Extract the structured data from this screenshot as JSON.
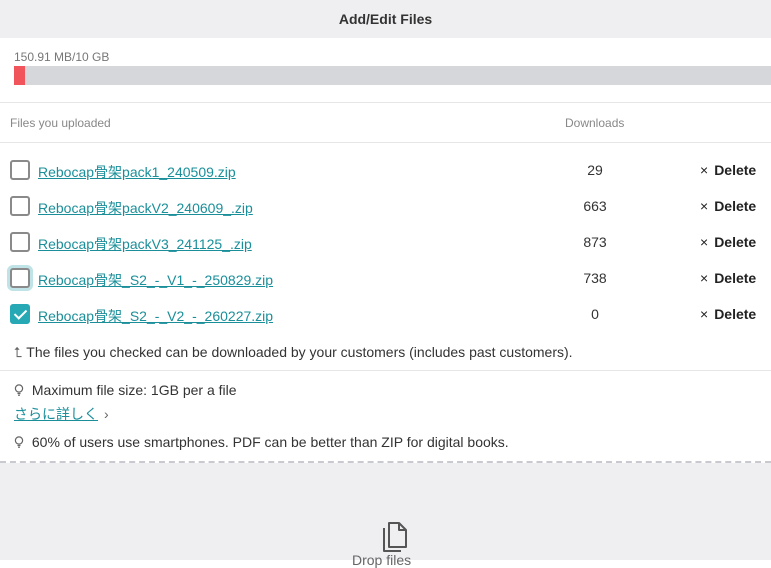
{
  "header": {
    "title": "Add/Edit Files"
  },
  "storage": {
    "label": "150.91 MB/10 GB",
    "used_fraction": 0.0151,
    "bar_color": "#f2545b"
  },
  "table": {
    "col_files": "Files you uploaded",
    "col_downloads": "Downloads",
    "delete_label": "Delete",
    "rows": [
      {
        "name": "Rebocap骨架pack1_240509.zip",
        "downloads": "29",
        "checked": false
      },
      {
        "name": "Rebocap骨架packV2_240609_.zip",
        "downloads": "663",
        "checked": false
      },
      {
        "name": "Rebocap骨架packV3_241125_.zip",
        "downloads": "873",
        "checked": false
      },
      {
        "name": "Rebocap骨架_S2_-_V1_-_250829.zip",
        "downloads": "738",
        "checked": false
      },
      {
        "name": "Rebocap骨架_S2_-_V2_-_260227.zip",
        "downloads": "0",
        "checked": true
      }
    ]
  },
  "notes": {
    "checked_info": "The files you checked can be downloaded by your customers (includes past customers).",
    "max_size": "Maximum file size: 1GB per a file",
    "learn_more": "さらに詳しく",
    "tip": "60% of users use smartphones. PDF can be better than ZIP for digital books."
  },
  "dropzone": {
    "label": "Drop files"
  },
  "colors": {
    "accent": "#1a8f9a",
    "checkbox_checked": "#27a8b5"
  }
}
